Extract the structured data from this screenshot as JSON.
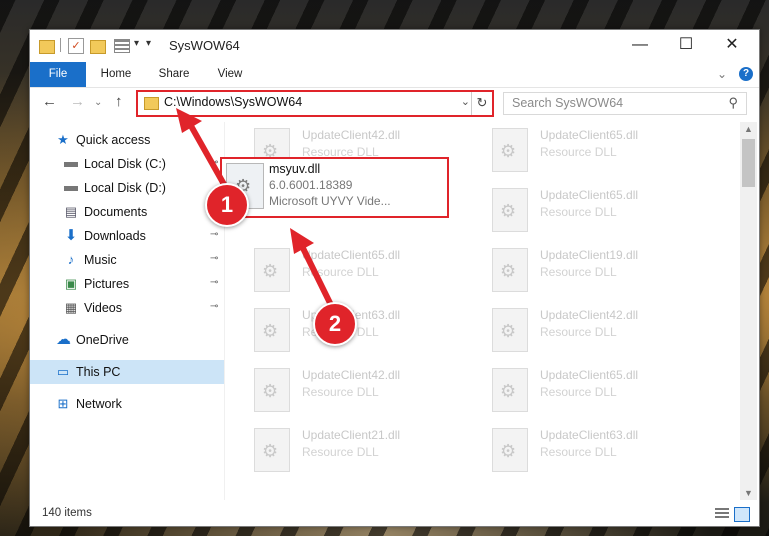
{
  "window": {
    "title": "SysWOW64",
    "minimize": "—",
    "maximize": "☐",
    "close": "✕"
  },
  "ribbon": {
    "tabs": [
      "File",
      "Home",
      "Share",
      "View"
    ],
    "collapse_glyph": "⌄",
    "help_glyph": "?"
  },
  "nav": {
    "back": "←",
    "forward": "→",
    "recent": "⌄",
    "up": "↑"
  },
  "address": {
    "path": "C:\\Windows\\SysWOW64",
    "dropdown_glyph": "⌄",
    "refresh_glyph": "↻"
  },
  "search": {
    "placeholder": "Search SysWOW64",
    "icon": "search-icon"
  },
  "sidebar": {
    "items": [
      {
        "label": "Quick access",
        "icon": "star-icon",
        "pinned": false
      },
      {
        "label": "Local Disk (C:)",
        "icon": "drive-icon",
        "pinned": true
      },
      {
        "label": "Local Disk (D:)",
        "icon": "drive-icon",
        "pinned": false
      },
      {
        "label": "Documents",
        "icon": "documents-icon",
        "pinned": true
      },
      {
        "label": "Downloads",
        "icon": "downloads-icon",
        "pinned": true
      },
      {
        "label": "Music",
        "icon": "music-icon",
        "pinned": true
      },
      {
        "label": "Pictures",
        "icon": "pictures-icon",
        "pinned": true
      },
      {
        "label": "Videos",
        "icon": "videos-icon",
        "pinned": true
      },
      {
        "label": "OneDrive",
        "icon": "cloud-icon",
        "pinned": false
      },
      {
        "label": "This PC",
        "icon": "computer-icon",
        "pinned": false,
        "selected": true
      },
      {
        "label": "Network",
        "icon": "network-icon",
        "pinned": false
      }
    ],
    "pin_glyph": "📌"
  },
  "files": {
    "left_column": [
      {
        "name": "UpdateClient42.dll",
        "desc": "Resource DLL"
      },
      {
        "name": "UpdateClient65.dll",
        "desc": "Resource DLL"
      },
      {
        "name": "UpdateClient63.dll",
        "desc": "Resource DLL"
      },
      {
        "name": "UpdateClient42.dll",
        "desc": "Resource DLL"
      },
      {
        "name": "UpdateClient21.dll",
        "desc": "Resource DLL"
      }
    ],
    "right_column": [
      {
        "name": "UpdateClient65.dll",
        "desc": "Resource DLL"
      },
      {
        "name": "UpdateClient65.dll",
        "desc": "Resource DLL"
      },
      {
        "name": "UpdateClient19.dll",
        "desc": "Resource DLL"
      },
      {
        "name": "UpdateClient42.dll",
        "desc": "Resource DLL"
      },
      {
        "name": "UpdateClient65.dll",
        "desc": "Resource DLL"
      },
      {
        "name": "UpdateClient63.dll",
        "desc": "Resource DLL"
      }
    ],
    "highlighted": {
      "name": "msyuv.dll",
      "version": "6.0.6001.18389",
      "desc": "Microsoft UYVY Vide..."
    }
  },
  "status": {
    "item_count": "140 items"
  },
  "callouts": [
    "1",
    "2"
  ],
  "colors": {
    "accent": "#1a6fc9",
    "highlight_red": "#e0242a",
    "selected_bg": "#cce4f7"
  }
}
